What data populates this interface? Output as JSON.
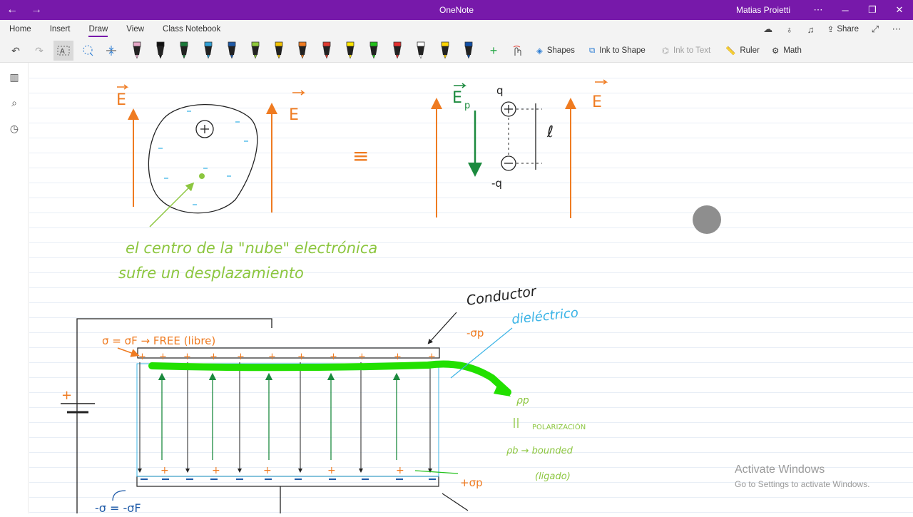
{
  "window": {
    "title": "OneNote",
    "user": "Matias Proietti"
  },
  "menu": {
    "items": [
      {
        "label": "Home"
      },
      {
        "label": "Insert"
      },
      {
        "label": "Draw"
      },
      {
        "label": "View"
      },
      {
        "label": "Class Notebook"
      }
    ],
    "active": "Draw",
    "share_label": "Share"
  },
  "toolbar": {
    "shapes_label": "Shapes",
    "ink_to_shape_label": "Ink to Shape",
    "ink_to_text_label": "Ink to Text",
    "ruler_label": "Ruler",
    "math_label": "Math",
    "pens": [
      {
        "color": "#e6a6c6"
      },
      {
        "color": "#111111"
      },
      {
        "color": "#1b7a3a"
      },
      {
        "color": "#2e9fd6"
      },
      {
        "color": "#1e5aa8"
      },
      {
        "color": "#8fc93a"
      },
      {
        "color": "#f2c200"
      },
      {
        "color": "#ef7b21"
      },
      {
        "color": "#e03a2f"
      },
      {
        "color": "#ffe600"
      },
      {
        "color": "#22c11b"
      },
      {
        "color": "#e53030"
      },
      {
        "color": "#ffffff"
      },
      {
        "color": "#ffd400"
      },
      {
        "color": "#0f4fa8"
      }
    ]
  },
  "notes": {
    "field_label": "E",
    "polarization_field_label": "E",
    "polarization_field_subscript": "p",
    "charge_top": "q",
    "charge_bottom": "-q",
    "dipole_length": "ℓ",
    "equals_sign": "≡",
    "caption_line1": "el centro de la \"nube\" electrónica",
    "caption_line2": "sufre un desplazamiento",
    "conductor_label": "Conductor",
    "dielectric_label": "dieléctrico",
    "sigma_eq": "σ = σF → FREE (libre)",
    "sigma_p_top": "-σp",
    "sigma_p_bottom": "+σp",
    "sigma_bottom": "-σ = -σF",
    "rho_p": "ρp",
    "polarization_word": "POLARIZACIÓN",
    "rho_b": "ρb → bounded",
    "ligado": "(ligado)",
    "battery_plus": "+",
    "colors": {
      "orange": "#ef7b21",
      "green": "#1b8a3e",
      "lime": "#8cc63f",
      "highlight": "#22e000",
      "cyan": "#3bb4e6"
    }
  },
  "watermark": {
    "title": "Activate Windows",
    "subtitle": "Go to Settings to activate Windows."
  }
}
